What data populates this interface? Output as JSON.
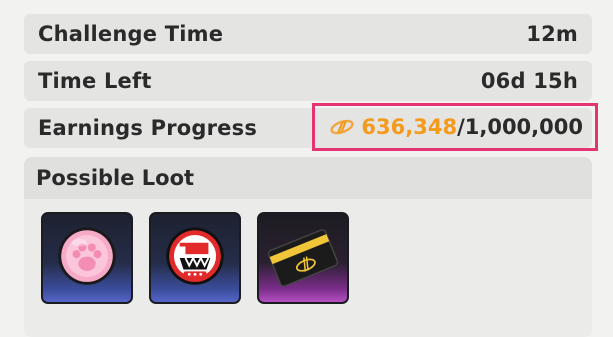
{
  "rows": {
    "challenge_time": {
      "label": "Challenge Time",
      "value": "12m"
    },
    "time_left": {
      "label": "Time Left",
      "value": "06d 15h"
    },
    "earnings": {
      "label": "Earnings Progress",
      "current": "636,348",
      "total": "/1,000,000"
    }
  },
  "loot": {
    "title": "Possible Loot",
    "items": [
      {
        "icon": "paw-coin-icon",
        "rarity_color": "#4a5bbd"
      },
      {
        "icon": "rpg-emblem-icon",
        "rarity_color": "#4a5bbd"
      },
      {
        "icon": "black-card-icon",
        "rarity_color": "#a441b5"
      }
    ]
  },
  "colors": {
    "highlight_border": "#e43572",
    "earnings_current": "#f49a1c"
  }
}
